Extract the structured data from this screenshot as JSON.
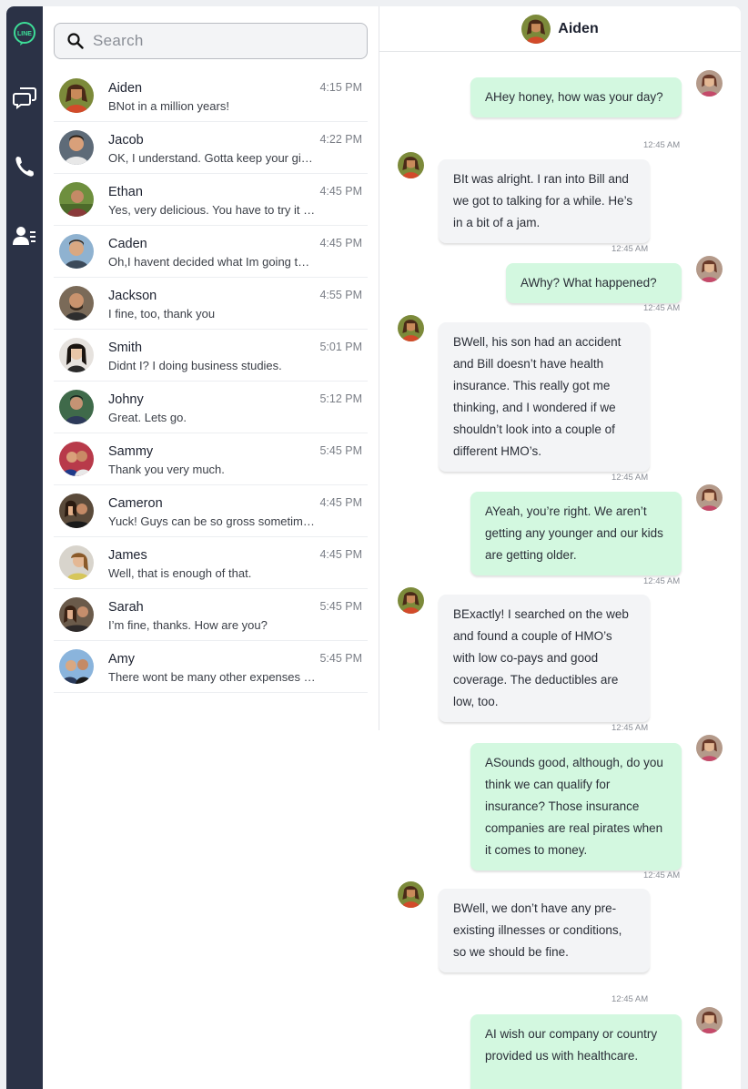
{
  "rail": {
    "logo_text": "LINE",
    "icons": [
      "line-logo-icon",
      "chat-icon",
      "phone-icon",
      "contacts-icon"
    ],
    "accent": "#3ddc97",
    "background": "#2b3246"
  },
  "search": {
    "placeholder": "Search",
    "value": ""
  },
  "conversations": [
    {
      "name": "Aiden",
      "time": "4:15 PM",
      "preview": "BNot in a million years!"
    },
    {
      "name": "Jacob",
      "time": "4:22 PM",
      "preview": "OK, I understand. Gotta keep your girl happy!"
    },
    {
      "name": "Ethan",
      "time": "4:45 PM",
      "preview": "Yes, very delicious. You have to try it sometime."
    },
    {
      "name": "Caden",
      "time": "4:45 PM",
      "preview": "Oh,I havent decided what Im going to do yet."
    },
    {
      "name": "Jackson",
      "time": "4:55 PM",
      "preview": "I fine, too, thank you"
    },
    {
      "name": "Smith",
      "time": "5:01 PM",
      "preview": "Didnt I? I doing business studies."
    },
    {
      "name": "Johny",
      "time": "5:12 PM",
      "preview": "Great. Lets go."
    },
    {
      "name": "Sammy",
      "time": "5:45 PM",
      "preview": "Thank you very much."
    },
    {
      "name": "Cameron",
      "time": "4:45 PM",
      "preview": "Yuck! Guys can be so gross sometimes."
    },
    {
      "name": "James",
      "time": "4:45 PM",
      "preview": "Well, that is enough of that."
    },
    {
      "name": "Sarah",
      "time": "5:45 PM",
      "preview": "I’m fine, thanks. How are you?"
    },
    {
      "name": "Amy",
      "time": "5:45 PM",
      "preview": "There wont be many other expenses though."
    }
  ],
  "chat": {
    "contact_name": "Aiden",
    "messages": [
      {
        "dir": "out",
        "text": "AHey honey, how was your day?",
        "time": "12:45 AM"
      },
      {
        "dir": "in",
        "text": "BIt was alright. I ran into Bill and we got to talking for a while. He’s in a bit of a jam.",
        "time": "12:45 AM"
      },
      {
        "dir": "out",
        "text": "AWhy? What happened?",
        "time": "12:45 AM"
      },
      {
        "dir": "in",
        "text": "BWell, his son had an accident and Bill doesn’t have health insurance. This really got me thinking, and I wondered if we shouldn’t look into a couple of different HMO’s.",
        "time": "12:45 AM"
      },
      {
        "dir": "out",
        "text": "AYeah, you’re right. We aren’t getting any younger and our kids are getting older.",
        "time": "12:45 AM"
      },
      {
        "dir": "in",
        "text": "BExactly! I searched on the web and found a couple of HMO’s with low co-pays and good coverage. The deductibles are low, too.",
        "time": "12:45 AM"
      },
      {
        "dir": "out",
        "text": "ASounds good, although, do you think we can qualify for insurance? Those insurance companies are real pirates when it comes to money.",
        "time": "12:45 AM"
      },
      {
        "dir": "in",
        "text": "BWell, we don’t have any pre-existing illnesses or conditions, so we should be fine.",
        "time": "12:45 AM"
      },
      {
        "dir": "out",
        "text": "AI wish our company or country provided us with healthcare.",
        "time": ""
      }
    ]
  },
  "colors": {
    "outgoing_bubble": "#d3f8e0",
    "incoming_bubble": "#f3f4f6",
    "timestamp": "#8a8e96"
  }
}
